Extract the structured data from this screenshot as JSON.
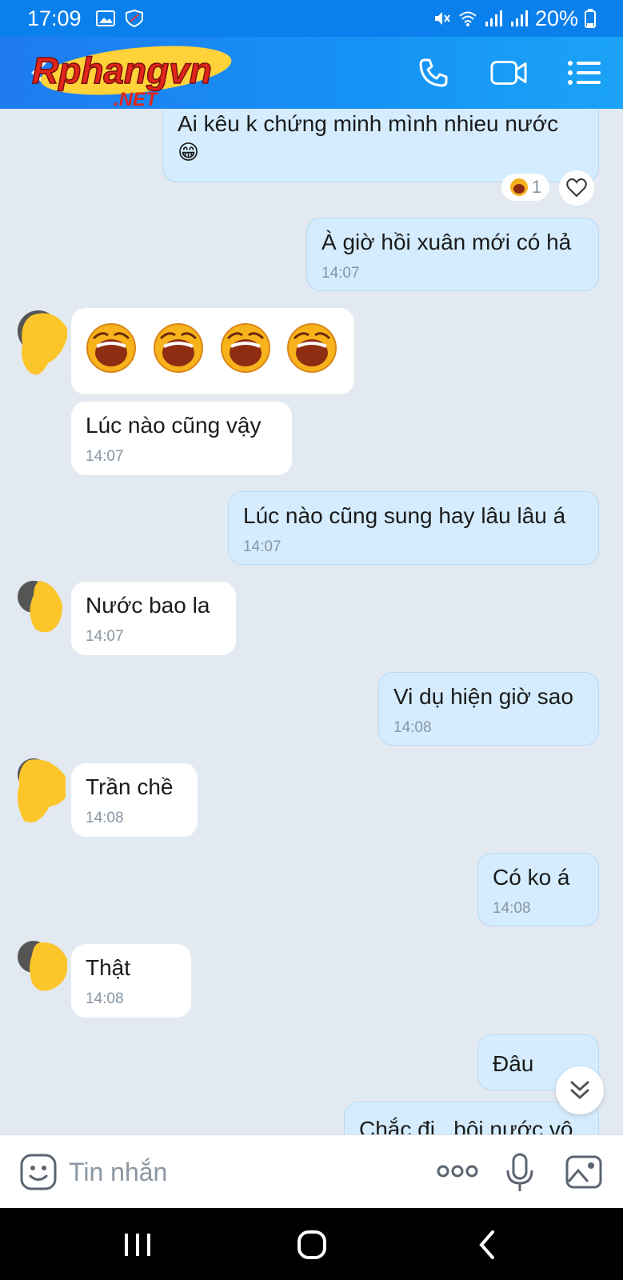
{
  "status_bar": {
    "time": "17:09",
    "battery": "20%"
  },
  "header": {
    "logo_text": "Rphangvn",
    "logo_subtext": ".NET",
    "actions": [
      "phone-icon",
      "video-icon",
      "menu-icon"
    ]
  },
  "messages": [
    {
      "side": "me",
      "text": "Ai kêu k chứng minh mình nhieu nước",
      "emoji": "😁",
      "reaction_count": "1"
    },
    {
      "side": "me",
      "text": "À giờ hồi xuân mới có hả",
      "time": "14:07"
    },
    {
      "side": "them",
      "type": "stickers",
      "count": 4
    },
    {
      "side": "them",
      "text": "Lúc nào cũng vậy",
      "time": "14:07"
    },
    {
      "side": "me",
      "text": "Lúc nào cũng sung hay lâu lâu á",
      "time": "14:07"
    },
    {
      "side": "them",
      "text": "Nước bao la",
      "time": "14:07"
    },
    {
      "side": "me",
      "text": "Vi dụ hiện giờ sao",
      "time": "14:08"
    },
    {
      "side": "them",
      "text": "Trần chề",
      "time": "14:08"
    },
    {
      "side": "me",
      "text": "Có ko á",
      "time": "14:08"
    },
    {
      "side": "them",
      "text": "Thật",
      "time": "14:08"
    },
    {
      "side": "me",
      "text": "Đâu"
    },
    {
      "side": "me",
      "text": "Chắc đi...bôi nước vô"
    }
  ],
  "input": {
    "placeholder": "Tin nhắn"
  },
  "colors": {
    "accent": "#0a80ec",
    "my_bubble": "#d4ecfe",
    "their_bubble": "#ffffff",
    "background": "#e2e9f1"
  }
}
